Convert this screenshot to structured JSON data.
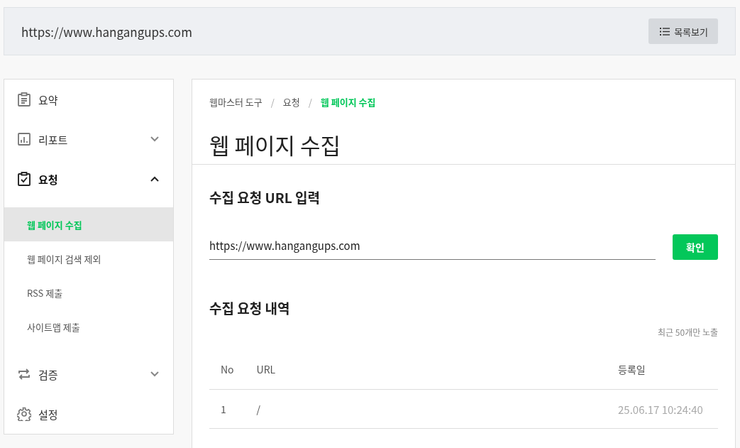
{
  "header": {
    "url": "https://www.hangangups.com",
    "list_button": "목록보기"
  },
  "sidebar": {
    "items": [
      {
        "label": "요약",
        "kind": "link"
      },
      {
        "label": "리포트",
        "kind": "group",
        "expanded": false
      },
      {
        "label": "요청",
        "kind": "group",
        "expanded": true,
        "children": [
          {
            "label": "웹 페이지 수집",
            "selected": true
          },
          {
            "label": "웹 페이지 검색 제외",
            "selected": false
          },
          {
            "label": "RSS 제출",
            "selected": false
          },
          {
            "label": "사이트맵 제출",
            "selected": false
          }
        ]
      },
      {
        "label": "검증",
        "kind": "group",
        "expanded": false
      },
      {
        "label": "설정",
        "kind": "link"
      }
    ]
  },
  "breadcrumb": [
    {
      "label": "웹마스터 도구",
      "selected": false
    },
    {
      "label": "요청",
      "selected": false
    },
    {
      "label": "웹 페이지 수집",
      "selected": true
    }
  ],
  "breadcrumb_separators": [
    "/",
    "/"
  ],
  "page_title": "웹 페이지 수집",
  "request_section": {
    "title": "수집 요청 URL 입력",
    "url_value": "https://www.hangangups.com",
    "confirm_button": "확인"
  },
  "history_section": {
    "title": "수집 요청 내역",
    "note": "최근 50개만 노출",
    "table": {
      "columns": [
        "No",
        "URL",
        "등록일"
      ],
      "rows": [
        [
          "1",
          "/",
          "25.06.17 10:24:40"
        ]
      ]
    }
  }
}
